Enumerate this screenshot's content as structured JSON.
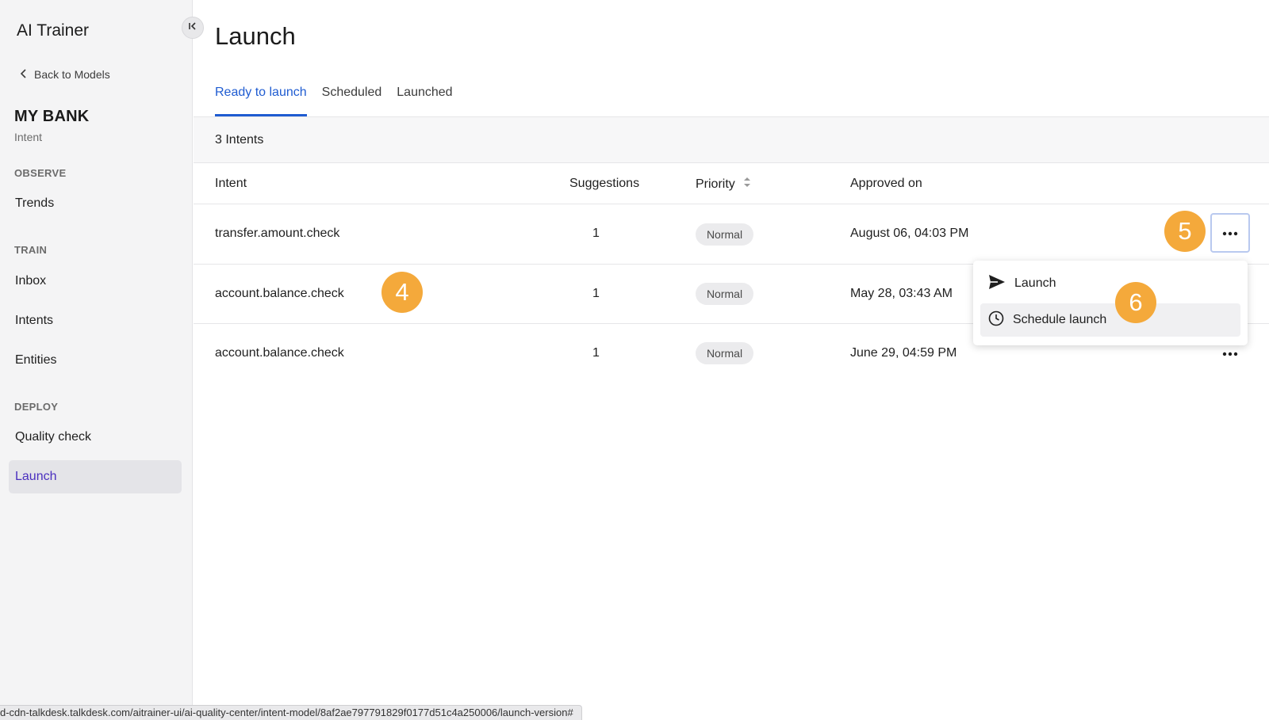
{
  "sidebar": {
    "app_title": "AI Trainer",
    "back_label": "Back to Models",
    "org_name": "MY BANK",
    "org_subtitle": "Intent",
    "sections": {
      "observe": "OBSERVE",
      "train": "TRAIN",
      "deploy": "DEPLOY"
    },
    "items": {
      "trends": "Trends",
      "inbox": "Inbox",
      "intents": "Intents",
      "entities": "Entities",
      "quality_check": "Quality check",
      "launch": "Launch"
    },
    "active_item": "Launch"
  },
  "main": {
    "title": "Launch",
    "tabs": [
      "Ready to launch",
      "Scheduled",
      "Launched"
    ],
    "active_tab": "Ready to launch",
    "count_text": "3 Intents",
    "columns": {
      "intent": "Intent",
      "suggestions": "Suggestions",
      "priority": "Priority",
      "approved_on": "Approved on"
    },
    "rows": [
      {
        "intent": "transfer.amount.check",
        "suggestions": "1",
        "priority": "Normal",
        "approved_on": "August 06, 04:03 PM"
      },
      {
        "intent": "account.balance.check",
        "suggestions": "1",
        "priority": "Normal",
        "approved_on": "May 28, 03:43 AM"
      },
      {
        "intent": "account.balance.check",
        "suggestions": "1",
        "priority": "Normal",
        "approved_on": "June 29, 04:59 PM"
      }
    ]
  },
  "menu": {
    "launch": "Launch",
    "schedule_launch": "Schedule launch"
  },
  "steps": {
    "four": "4",
    "five": "5",
    "six": "6"
  },
  "status_url": "d-cdn-talkdesk.talkdesk.com/aitrainer-ui/ai-quality-center/intent-model/8af2ae797791829f0177d51c4a250006/launch-version#",
  "colors": {
    "accent": "#1f5cd1",
    "active_nav": "#4a2fbf",
    "step_marker": "#f4a93b"
  }
}
